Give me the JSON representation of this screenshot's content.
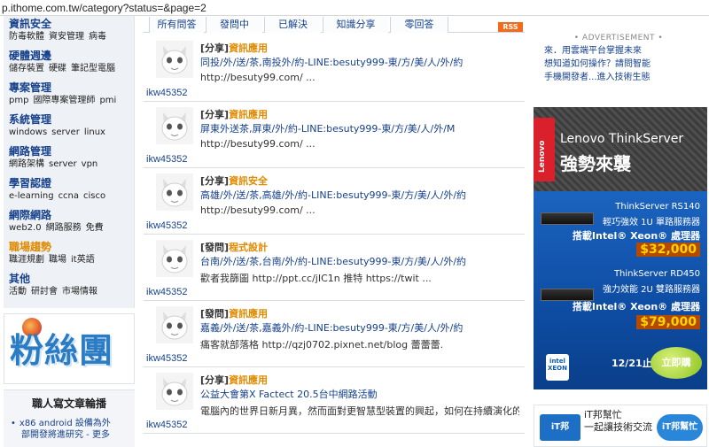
{
  "url": "p.ithome.com.tw/category?status=&page=2",
  "sidebar": {
    "categories": [
      {
        "title": "資訊安全",
        "subs": [
          "防毒軟體",
          "資安管理",
          "病毒"
        ],
        "color": "#16418c"
      },
      {
        "title": "硬體週邊",
        "subs": [
          "儲存裝置",
          "硬碟",
          "筆記型電腦"
        ],
        "color": "#16418c"
      },
      {
        "title": "專案管理",
        "subs": [
          "pmp",
          "國際專案管理師",
          "pmi"
        ],
        "color": "#16418c"
      },
      {
        "title": "系統管理",
        "subs": [
          "windows",
          "server",
          "linux"
        ],
        "color": "#16418c"
      },
      {
        "title": "網路管理",
        "subs": [
          "網路架構",
          "server",
          "vpn"
        ],
        "color": "#16418c"
      },
      {
        "title": "學習認證",
        "subs": [
          "e-learning",
          "ccna",
          "cisco"
        ],
        "color": "#16418c"
      },
      {
        "title": "網際網路",
        "subs": [
          "web2.0",
          "網路服務",
          "免費"
        ],
        "color": "#16418c"
      },
      {
        "title": "職場趨勢",
        "subs": [
          "職涯規劃",
          "職場",
          "it英語"
        ],
        "color": "#e08a00"
      },
      {
        "title": "其他",
        "subs": [
          "活動",
          "研討會",
          "市場情報"
        ],
        "color": "#16418c"
      }
    ]
  },
  "fans": {
    "logo_text": "粉絲團"
  },
  "writer": {
    "title": "職人寫文章輪播",
    "items": [
      "x86 android 設備為外",
      "部開發將進研究 - 更多"
    ]
  },
  "tabs": [
    "所有問答",
    "發問中",
    "已解決",
    "知識分享",
    "零回答"
  ],
  "rss_label": "RSS",
  "posts": [
    {
      "tag": "[分享]",
      "category": "資訊應用",
      "subtitle": "同投/外/送/茶,南投外/約-LINE:besuty999-東/方/美/人/外/約",
      "body": "http://besuty99.com/ ...",
      "author": "ikw45352"
    },
    {
      "tag": "[分享]",
      "category": "資訊應用",
      "subtitle": "屏東外送茶,屏東/外/約-LINE:besuty999-東/方/美/人/外/M",
      "body": "http://besuty99.com/ ...",
      "author": "ikw45352"
    },
    {
      "tag": "[分享]",
      "category": "資訊安全",
      "subtitle": "高雄/外/送/茶,高雄/外/約-LINE:besuty999-東/方/美/人/外/約",
      "body": "http://besuty99.com/ ...",
      "author": "ikw45352"
    },
    {
      "tag": "[發問]",
      "category": "程式設計",
      "subtitle": "台南/外/送/茶,台南/外/約-LINE:besuty999-東/方/美/人/外/約",
      "body": "歡者我篩圖 http://ppt.cc/jIC1n 推特 https://twit ...",
      "author": "ikw45352"
    },
    {
      "tag": "[發問]",
      "category": "資訊應用",
      "subtitle": "嘉義/外/送/茶,嘉義外/約-LINE:besuty999-東/方/美/人/外/約",
      "body": "痛客就部落格 http://qzj0702.pixnet.net/blog 蕾蕾蕾.",
      "author": "ikw45352"
    },
    {
      "tag": "[分享]",
      "category": "資訊應用",
      "subtitle": "公益大會第X Factect 20.5台中網路活動",
      "body": "電腦內的世界日新月異，然而面對更智慧型裝置的興起，如何在持續演化的高效能之外另外構成連接一換...",
      "author": "ikw45352"
    }
  ],
  "ad_text": {
    "header": "• ADVERTISEMENT •",
    "items": [
      "來．用雲端平台掌握未來",
      "想知道如何操作？請問智能",
      "手機開發者...進入技術生態"
    ]
  },
  "lenovo": {
    "logo": "Lenovo",
    "brand": "Lenovo ThinkServer",
    "slogan": "強勢來襲"
  },
  "thinkserver": {
    "model1": "ThinkServer RS140",
    "desc1": "輕巧強效 1U 單路服務器",
    "cpu1": "搭載Intel® Xeon® 處理器",
    "price1": "$32,000",
    "model2": "ThinkServer RD450",
    "desc2": "強力效能 2U 雙路服務器",
    "cpu2": "搭載Intel® Xeon® 處理器",
    "price2": "$79,000",
    "date": "12/21止",
    "cta": "立即購",
    "intel": "intel XEON"
  },
  "itbang": {
    "left": "iT邦",
    "text": "iT邦幫忙\n一起讓技術交流",
    "right": "iT邦幫忙"
  }
}
